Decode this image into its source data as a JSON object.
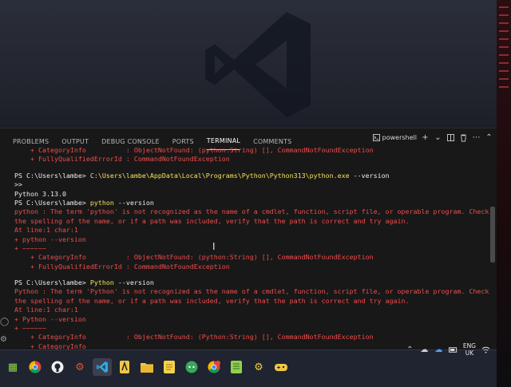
{
  "panel": {
    "tabs": [
      {
        "label": "PROBLEMS"
      },
      {
        "label": "OUTPUT"
      },
      {
        "label": "DEBUG CONSOLE"
      },
      {
        "label": "PORTS"
      },
      {
        "label": "TERMINAL"
      },
      {
        "label": "COMMENTS"
      }
    ],
    "terminal_name": "powershell",
    "icons": [
      "terminal-icon",
      "add-icon",
      "chevron-down-icon",
      "split-icon",
      "trash-icon",
      "more-icon",
      "chevron-up-icon"
    ]
  },
  "terminal": {
    "lines": [
      "    + CategoryInfo          : ObjectNotFound: (python:String) [], CommandNotFoundException",
      "    + FullyQualifiedErrorId : CommandNotFoundException",
      "",
      "PS C:\\Users\\lambe> ",
      "C:\\Users\\lambe\\AppData\\Local\\Programs\\Python\\Python313\\python.exe",
      " --version",
      ">>",
      "Python 3.13.0",
      "PS C:\\Users\\lambe> ",
      "python",
      " --version",
      "python : The term 'python' is not recognized as the name of a cmdlet, function, script file, or operable program. Check",
      "the spelling of the name, or if a path was included, verify that the path is correct and try again.",
      "At line:1 char:1",
      "+ python --version",
      "+ ~~~~~~",
      "    + CategoryInfo          : ObjectNotFound: (python:String) [], CommandNotFoundException",
      "    + FullyQualifiedErrorId : CommandNotFoundException",
      "PS C:\\Users\\lambe> ",
      "Python",
      " --version",
      "Python : The term 'Python' is not recognized as the name of a cmdlet, function, script file, or operable program. Check",
      "the spelling of the name, or if a path was included, verify that the path is correct and try again.",
      "At line:1 char:1",
      "+ Python --version",
      "+ ~~~~~~",
      "    + CategoryInfo          : ObjectNotFound: (Python:String) [], CommandNotFoundException",
      "    + CategoryInfo"
    ]
  },
  "taskbar": {
    "apps": [
      "windows-start-icon",
      "chrome-icon",
      "github-icon",
      "settings-gear-icon",
      "vscode-icon",
      "app-icon",
      "file-explorer-icon",
      "notes-icon",
      "discord-icon",
      "chrome-profile-icon",
      "notepad-icon",
      "gear-icon",
      "game-icon"
    ],
    "lang_top": "ENG",
    "lang_bottom": "UK"
  },
  "colors": {
    "error": "#f14c4c",
    "command": "#f5e356",
    "panel_bg": "#181818"
  }
}
